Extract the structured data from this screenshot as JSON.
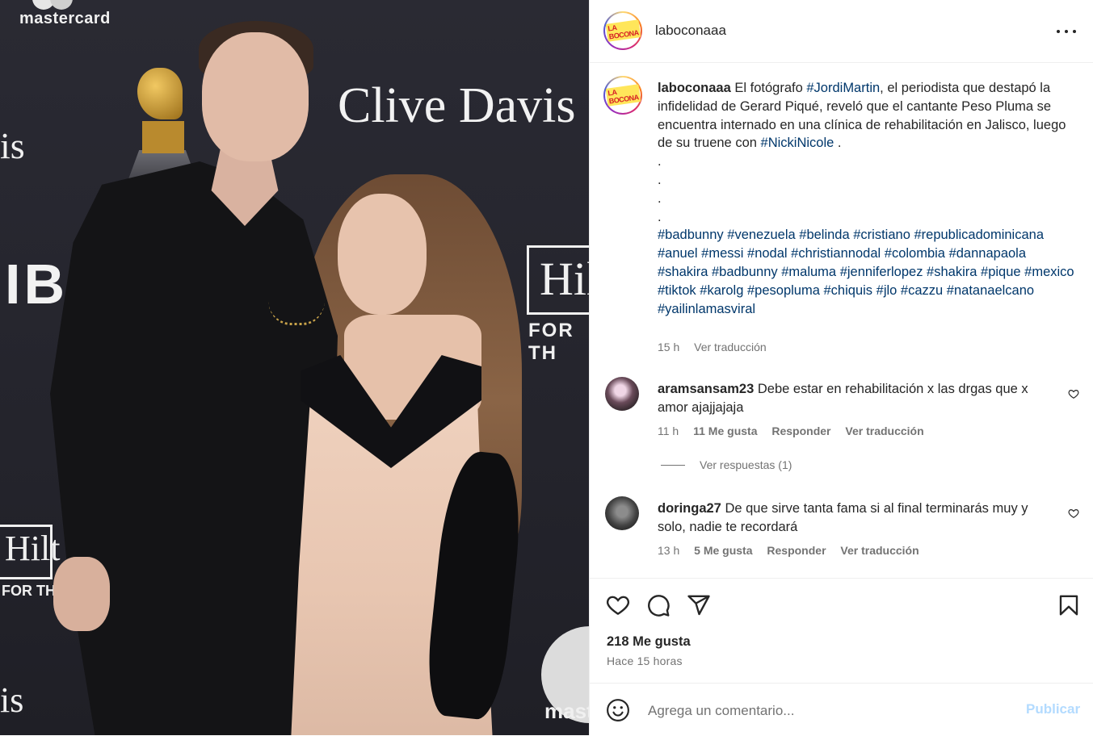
{
  "photo": {
    "sponsor_mastercard": "mastercard",
    "sponsor_mastercard_2": "mast",
    "event_name": "Clive Davis",
    "sponsor_ibm": "IBM",
    "sponsor_hilton": "Hil",
    "sponsor_hilton_tagline": "FOR TH",
    "sponsor_hilton_2": "Hilt",
    "sponsor_hilton_tagline_2": "FOR THE",
    "fragment_is": "is",
    "fragment_is_2": "is"
  },
  "header": {
    "username": "laboconaaa",
    "avatar_text": "LA BOCONA"
  },
  "caption": {
    "username": "laboconaaa",
    "text_1": "El fotógrafo ",
    "tag_1": "#JordiMartin",
    "text_2": ", el periodista que destapó la infidelidad de Gerard Piqué, reveló que el cantante Peso Pluma se encuentra internado en una clínica de rehabilitación en Jalisco, luego de su truene con ",
    "tag_2": "#NickiNicole",
    "text_3": " .",
    "dots": [
      ".",
      ".",
      ".",
      "."
    ],
    "hashtags": [
      "#badbunny",
      "#venezuela",
      "#belinda",
      "#cristiano",
      "#republicadominicana",
      "#anuel",
      "#messi",
      "#nodal",
      "#christiannodal",
      "#colombia",
      "#dannapaola",
      "#shakira",
      "#badbunny",
      "#maluma",
      "#jenniferlopez",
      "#shakira",
      "#pique",
      "#mexico",
      "#tiktok",
      "#karolg",
      "#pesopluma",
      "#chiquis",
      "#jlo",
      "#cazzu",
      "#natanaelcano",
      "#yailinlamasviral"
    ],
    "time": "15 h",
    "translate": "Ver traducción"
  },
  "comments": [
    {
      "username": "aramsansam23",
      "text": "Debe estar en rehabilitación x las drgas que x amor ajajjajaja",
      "time": "11 h",
      "likes": "11 Me gusta",
      "reply": "Responder",
      "translate": "Ver traducción",
      "view_replies": "Ver respuestas (1)"
    },
    {
      "username": "doringa27",
      "text": "De que sirve tanta fama si al final terminarás muy y solo, nadie te recordará",
      "time": "13 h",
      "likes": "5 Me gusta",
      "reply": "Responder",
      "translate": "Ver traducción"
    }
  ],
  "footer": {
    "likes": "218 Me gusta",
    "timestamp": "Hace 15 horas",
    "comment_placeholder": "Agrega un comentario...",
    "publish_label": "Publicar"
  },
  "icons": {
    "like": "heart-icon",
    "comment": "comment-icon",
    "share": "paper-plane-icon",
    "save": "bookmark-icon",
    "more": "more-horizontal-icon",
    "emoji": "emoji-icon"
  },
  "colors": {
    "hashtag": "#00376b",
    "secondary_text": "#737373",
    "publish_disabled": "#b3dbff"
  }
}
